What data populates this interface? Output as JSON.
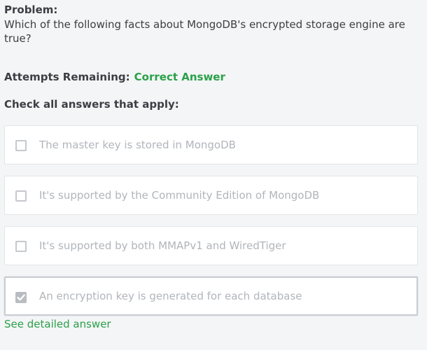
{
  "problem": {
    "label": "Problem:",
    "question": "Which of the following facts about MongoDB's encrypted storage engine are true?"
  },
  "attempts": {
    "label": "Attempts Remaining:",
    "value": "Correct Answer"
  },
  "instructions": "Check all answers that apply:",
  "options": [
    {
      "text": "The master key is stored in MongoDB",
      "checked": false
    },
    {
      "text": "It's supported by the Community Edition of MongoDB",
      "checked": false
    },
    {
      "text": "It's supported by both MMAPv1 and WiredTiger",
      "checked": false
    },
    {
      "text": "An encryption key is generated for each database",
      "checked": true
    }
  ],
  "detail_link": "See detailed answer",
  "colors": {
    "accent_green": "#2aa04a",
    "background": "#f4f5f6",
    "disabled_text": "#b1b5ba"
  }
}
